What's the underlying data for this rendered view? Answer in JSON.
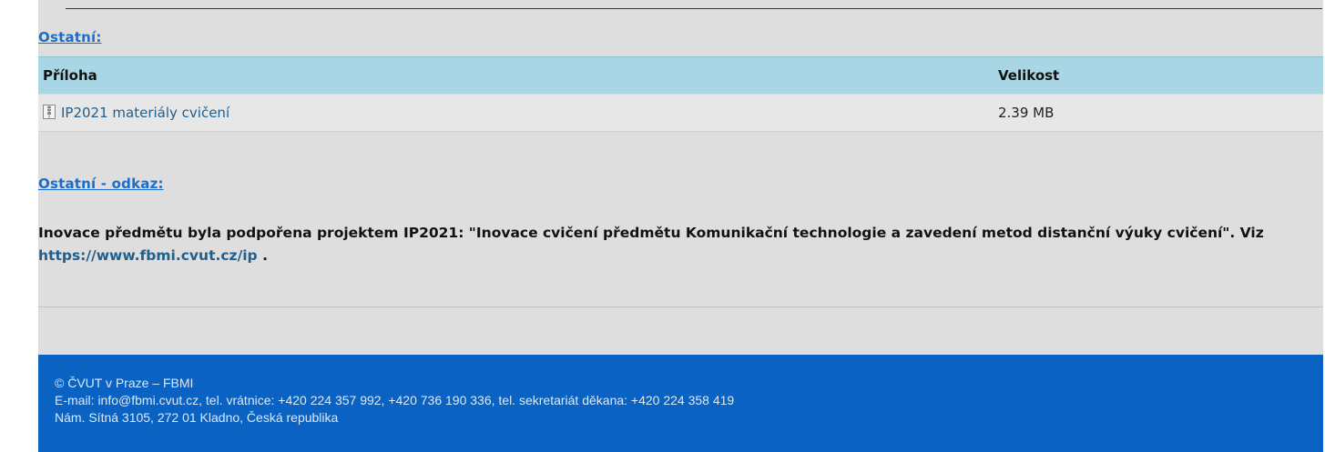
{
  "sections": {
    "other_title": "Ostatní:",
    "other_link_title": "Ostatní - odkaz:"
  },
  "attachments": {
    "headers": [
      "Příloha",
      "Velikost"
    ],
    "rows": [
      {
        "name": "IP2021 materiály cvičení",
        "size": "2.39 MB",
        "icon": "archive-file-icon"
      }
    ]
  },
  "info": {
    "text_before": "Inovace předmětu byla podpořena projektem IP2021: \"Inovace cvičení předmětu Komunikační technologie a zavedení metod distanční výuky cvičení\". Viz",
    "link": "https://www.fbmi.cvut.cz/ip",
    "text_after": "."
  },
  "footer": {
    "copyright": "© ČVUT v Praze – FBMI",
    "contacts": "E-mail: info@fbmi.cvut.cz, tel. vrátnice: +420 224 357 992, +420 736 190 336, tel. sekretariát děkana: +420 224 358 419",
    "address": "Nám. Sítná 3105, 272 01 Kladno, Česká republika"
  },
  "colors": {
    "background": "#dedede",
    "table_header": "#a9d6e5",
    "link": "#1a6fcc",
    "footer": "#0a62c2"
  }
}
